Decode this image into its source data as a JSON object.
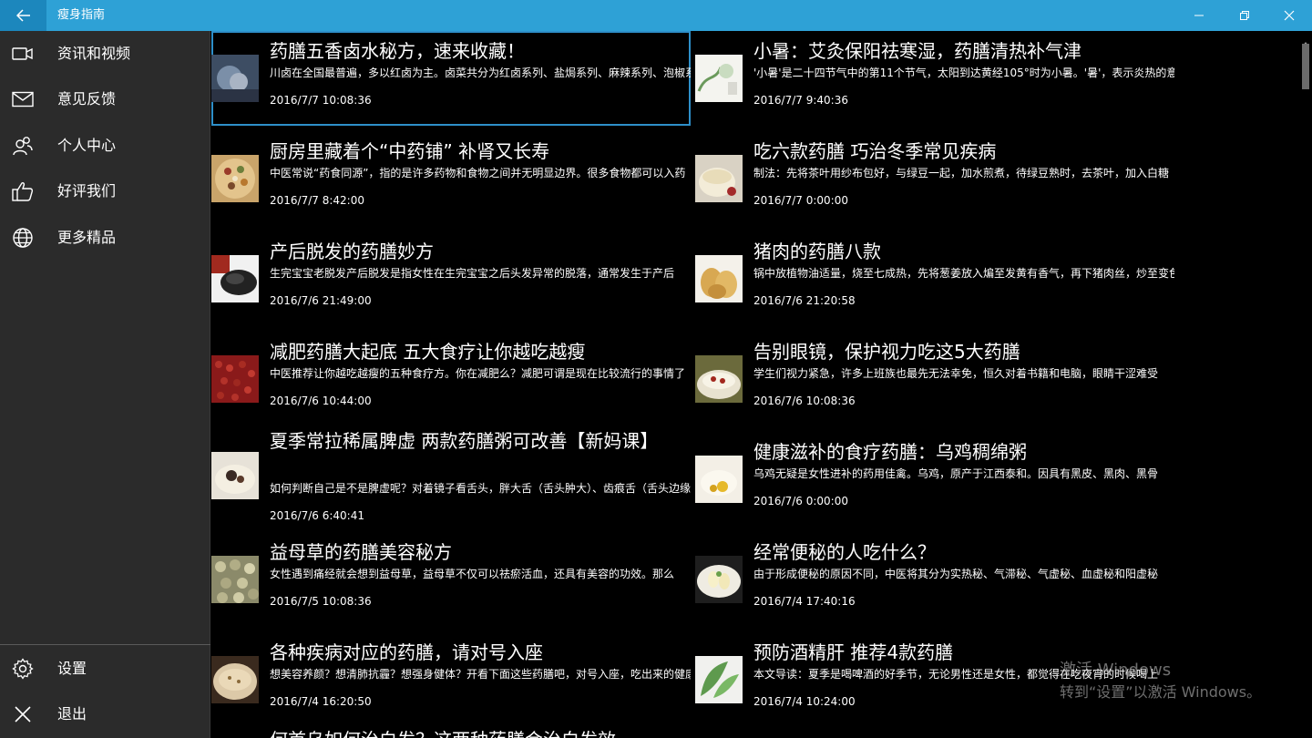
{
  "window": {
    "title": "瘦身指南",
    "accent": "#2ea1d6",
    "back_accent": "#1c87bd"
  },
  "sidebar": {
    "items": [
      {
        "label": "资讯和视频",
        "icon": "video-camera-icon"
      },
      {
        "label": "意见反馈",
        "icon": "mail-icon"
      },
      {
        "label": "个人中心",
        "icon": "people-icon"
      },
      {
        "label": "好评我们",
        "icon": "thumbs-up-icon"
      },
      {
        "label": "更多精品",
        "icon": "globe-icon"
      }
    ],
    "bottom_items": [
      {
        "label": "设置",
        "icon": "gear-icon"
      },
      {
        "label": "退出",
        "icon": "close-icon"
      }
    ]
  },
  "articles": [
    {
      "title": "药膳五香卤水秘方，速来收藏！",
      "desc": "川卤在全国最普遍，多以红卤为主。卤菜共分为红卤系列、盐焗系列、麻辣系列、泡椒系列",
      "date": "2016/7/7 10:08:36"
    },
    {
      "title": "小暑：艾灸保阳祛寒湿，药膳清热补气津",
      "desc": "'小暑'是二十四节气中的第11个节气，太阳到达黄经105°时为小暑。'暑'，表示炎热的意思",
      "date": "2016/7/7 9:40:36"
    },
    {
      "title": "厨房里藏着个“中药铺” 补肾又长寿",
      "desc": "中医常说“药食同源”，指的是许多药物和食物之间并无明显边界。很多食物都可以入药",
      "date": "2016/7/7 8:42:00"
    },
    {
      "title": "吃六款药膳 巧治冬季常见疾病",
      "desc": "制法：先将茶叶用纱布包好，与绿豆一起，加水煎煮，待绿豆熟时，去茶叶，加入白糖",
      "date": "2016/7/7 0:00:00"
    },
    {
      "title": "产后脱发的药膳妙方",
      "desc": "生完宝宝老脱发产后脱发是指女性在生完宝宝之后头发异常的脱落，通常发生于产后",
      "date": "2016/7/6 21:49:00"
    },
    {
      "title": "猪肉的药膳八款",
      "desc": "锅中放植物油适量，烧至七成热，先将葱姜放入煸至发黄有香气，再下猪肉丝，炒至变色",
      "date": "2016/7/6 21:20:58"
    },
    {
      "title": "减肥药膳大起底 五大食疗让你越吃越瘦",
      "desc": "中医推荐让你越吃越瘦的五种食疗方。你在减肥么？减肥可谓是现在比较流行的事情了",
      "date": "2016/7/6 10:44:00"
    },
    {
      "title": "告别眼镜，保护视力吃这5大药膳",
      "desc": "学生们视力紧急，许多上班族也最先无法幸免，恒久对着书籍和电脑，眼睛干涩难受",
      "date": "2016/7/6 10:08:36"
    },
    {
      "title": "夏季常拉稀属脾虚 两款药膳粥可改善【新妈课】",
      "desc": "如何判断自己是不是脾虚呢？对着镜子看舌头，胖大舌（舌头肿大）、齿痕舌（舌头边缘",
      "date": "2016/7/6 6:40:41"
    },
    {
      "title": "健康滋补的食疗药膳：乌鸡稠绵粥",
      "desc": "乌鸡无疑是女性进补的药用佳禽。乌鸡，原产于江西泰和。因具有黑皮、黑肉、黑骨",
      "date": "2016/7/6 0:00:00"
    },
    {
      "title": "益母草的药膳美容秘方",
      "desc": "女性遇到痛经就会想到益母草，益母草不仅可以祛瘀活血，还具有美容的功效。那么",
      "date": "2016/7/5 10:08:36"
    },
    {
      "title": "经常便秘的人吃什么？",
      "desc": "由于形成便秘的原因不同，中医将其分为实热秘、气滞秘、气虚秘、血虚秘和阳虚秘",
      "date": "2016/7/4 17:40:16"
    },
    {
      "title": "各种疾病对应的药膳，请对号入座",
      "desc": "想美容养颜？想清肺抗霾？想强身健体？开看下面这些药膳吧，对号入座，吃出来的健康",
      "date": "2016/7/4 16:20:50"
    },
    {
      "title": "预防酒精肝 推荐4款药膳",
      "desc": "本文导读：夏季是喝啤酒的好季节，无论男性还是女性，都觉得在吃夜宵的时候喝上",
      "date": "2016/7/4 10:24:00"
    },
    {
      "title": "何首乌如何治白发？这两种药膳会治白发效",
      "desc": "",
      "date": ""
    }
  ],
  "watermark": {
    "line1": "激活 Windows",
    "line2": "转到“设置”以激活 Windows。"
  }
}
